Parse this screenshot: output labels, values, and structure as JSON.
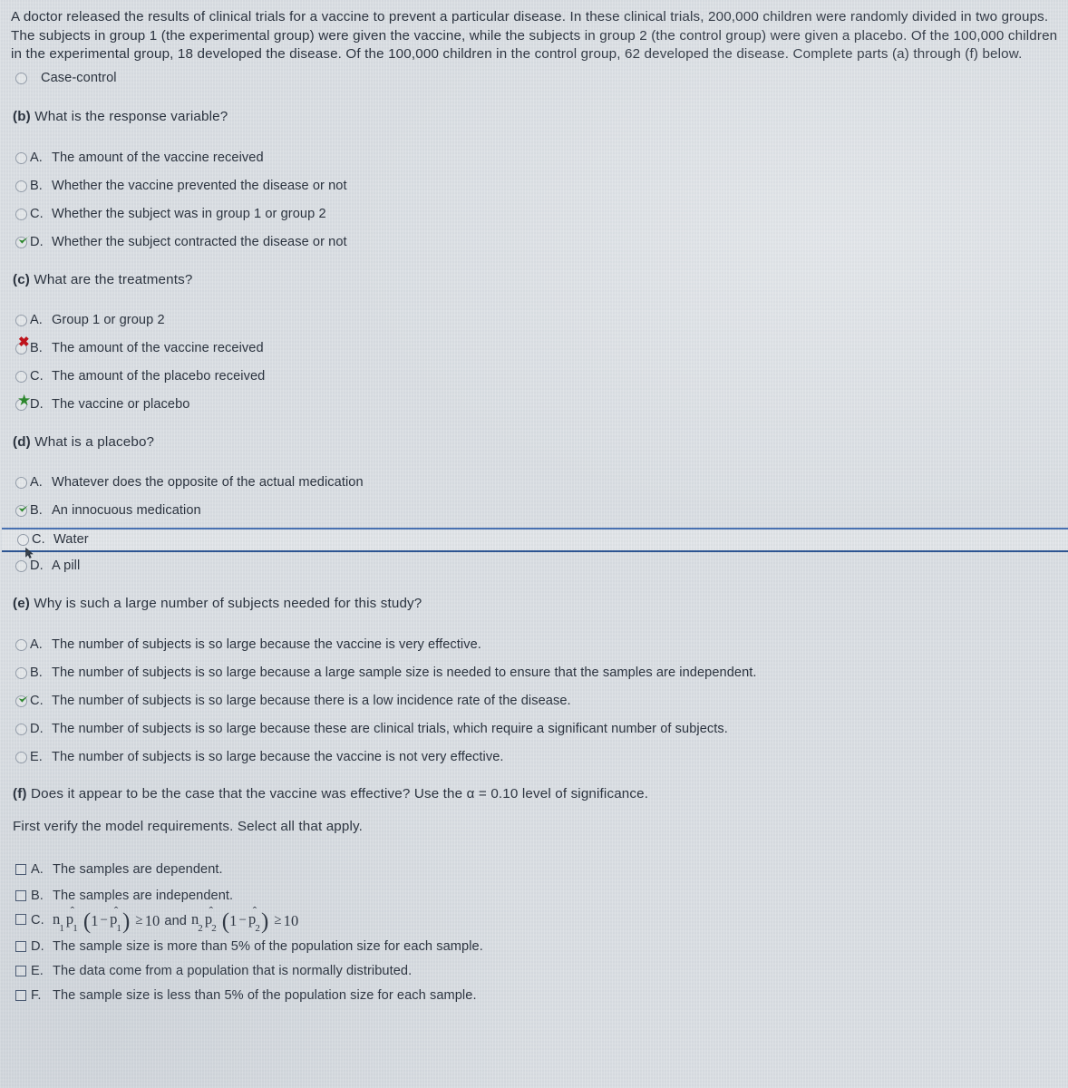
{
  "intro": {
    "paragraph": "A doctor released the results of clinical trials for a vaccine to prevent a particular disease. In these clinical trials, 200,000 children were randomly divided in two groups. The subjects in group 1 (the experimental group) were given the vaccine, while the subjects in group 2 (the control group) were given a placebo. Of the 100,000 children in the experimental group, 18 developed the disease. Of the 100,000 children in the control group, 62 developed the disease. Complete parts (a) through (f) below."
  },
  "part_a_leftover": {
    "label": "Case-control",
    "state": "unselected"
  },
  "part_b": {
    "prefix": "(b)",
    "question": "What is the response variable?",
    "options": [
      {
        "letter": "A.",
        "text": "The amount of the vaccine received",
        "mark": "none"
      },
      {
        "letter": "B.",
        "text": "Whether the vaccine prevented the disease or not",
        "mark": "none"
      },
      {
        "letter": "C.",
        "text": "Whether the subject was in group 1 or group 2",
        "mark": "none"
      },
      {
        "letter": "D.",
        "text": "Whether the subject contracted the disease or not",
        "mark": "check"
      }
    ]
  },
  "part_c": {
    "prefix": "(c)",
    "question": "What are the treatments?",
    "options": [
      {
        "letter": "A.",
        "text": "Group 1 or group 2",
        "mark": "none"
      },
      {
        "letter": "B.",
        "text": "The amount of the vaccine received",
        "mark": "cross"
      },
      {
        "letter": "C.",
        "text": "The amount of the placebo received",
        "mark": "none"
      },
      {
        "letter": "D.",
        "text": "The vaccine or placebo",
        "mark": "star"
      }
    ]
  },
  "part_d": {
    "prefix": "(d)",
    "question": "What is a placebo?",
    "options": [
      {
        "letter": "A.",
        "text": "Whatever does the opposite of the actual medication",
        "mark": "none",
        "focused": false
      },
      {
        "letter": "B.",
        "text": "An innocuous medication",
        "mark": "check",
        "focused": false
      },
      {
        "letter": "C.",
        "text": "Water",
        "mark": "none",
        "focused": true
      },
      {
        "letter": "D.",
        "text": "A pill",
        "mark": "none",
        "focused": false
      }
    ]
  },
  "part_e": {
    "prefix": "(e)",
    "question": "Why is such a large number of subjects needed for this study?",
    "options": [
      {
        "letter": "A.",
        "text": "The number of subjects is so large because the vaccine is very effective.",
        "mark": "none"
      },
      {
        "letter": "B.",
        "text": "The number of subjects is so large because a large sample size is needed to ensure that the samples are independent.",
        "mark": "none"
      },
      {
        "letter": "C.",
        "text": "The number of subjects is so large because there is a low incidence rate of the disease.",
        "mark": "check"
      },
      {
        "letter": "D.",
        "text": "The number of subjects is so large because these are clinical trials, which require a significant number of subjects.",
        "mark": "none"
      },
      {
        "letter": "E.",
        "text": "The number of subjects is so large because the vaccine is not very effective.",
        "mark": "none"
      }
    ]
  },
  "part_f": {
    "prefix": "(f)",
    "question": "Does it appear to be the case that the vaccine was effective? Use the α = 0.10 level of significance.",
    "instruction": "First verify the model requirements. Select all that apply.",
    "options": [
      {
        "letter": "A.",
        "text": "The samples are dependent.",
        "checked": false,
        "is_math": false
      },
      {
        "letter": "B.",
        "text": "The samples are independent.",
        "checked": false,
        "is_math": false
      },
      {
        "letter": "C.",
        "text": "n1p̂1(1 − p̂1) ≥ 10 and n2p̂2(1 − p̂2) ≥ 10",
        "checked": false,
        "is_math": true
      },
      {
        "letter": "D.",
        "text": "The sample size is more than 5% of the population size for each sample.",
        "checked": false,
        "is_math": false
      },
      {
        "letter": "E.",
        "text": "The data come from a population that is normally distributed.",
        "checked": false,
        "is_math": false
      },
      {
        "letter": "F.",
        "text": "The sample size is less than 5% of the population size for each sample.",
        "checked": false,
        "is_math": false
      }
    ],
    "math_c": {
      "n1": "n",
      "n1sub": "1",
      "p1": "p",
      "p1sub": "1",
      "one": "1",
      "minus": "−",
      "ge": "≥",
      "ten": "10",
      "and": "and",
      "n2": "n",
      "n2sub": "2",
      "p2": "p",
      "p2sub": "2"
    }
  },
  "colors": {
    "background": "#dfe3e7",
    "text": "#2c3440",
    "check_green": "#2e8b2e",
    "cross_red": "#c4131c",
    "focus_blue": "#3a66a8"
  }
}
